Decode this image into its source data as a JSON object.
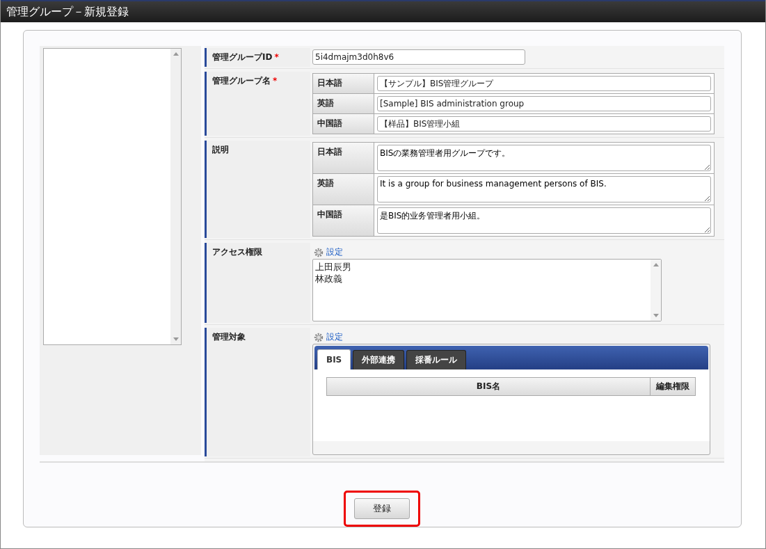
{
  "window": {
    "title": "管理グループ－新規登録"
  },
  "form": {
    "rows": [
      {
        "kind": "text",
        "label": "管理グループID",
        "required_mark": "*",
        "value": "5i4dmajm3d0h8v6"
      },
      {
        "kind": "multilang",
        "label": "管理グループ名",
        "required_mark": "*",
        "multiline": false,
        "entries": [
          {
            "lang": "日本語",
            "value": "【サンプル】BIS管理グループ"
          },
          {
            "lang": "英語",
            "value": "[Sample] BIS administration group"
          },
          {
            "lang": "中国語",
            "value": "【样品】BIS管理小組"
          }
        ]
      },
      {
        "kind": "multilang",
        "label": "説明",
        "multiline": true,
        "entries": [
          {
            "lang": "日本語",
            "value": "BISの業務管理者用グループです。"
          },
          {
            "lang": "英語",
            "value": "It is a group for business management persons of BIS."
          },
          {
            "lang": "中国語",
            "value": "是BIS的业务管理者用小組。"
          }
        ]
      },
      {
        "kind": "list",
        "label": "アクセス権限",
        "action": "設定",
        "items": [
          "上田辰男",
          "林政義"
        ]
      },
      {
        "kind": "tabs",
        "label": "管理対象",
        "action": "設定",
        "tabs": [
          {
            "label": "BIS",
            "selected": true
          },
          {
            "label": "外部連携",
            "selected": false
          },
          {
            "label": "採番ルール",
            "selected": false
          }
        ],
        "columns": [
          "BIS名",
          "編集権限"
        ]
      }
    ]
  },
  "submit": {
    "label": "登録",
    "highlighted": true
  }
}
